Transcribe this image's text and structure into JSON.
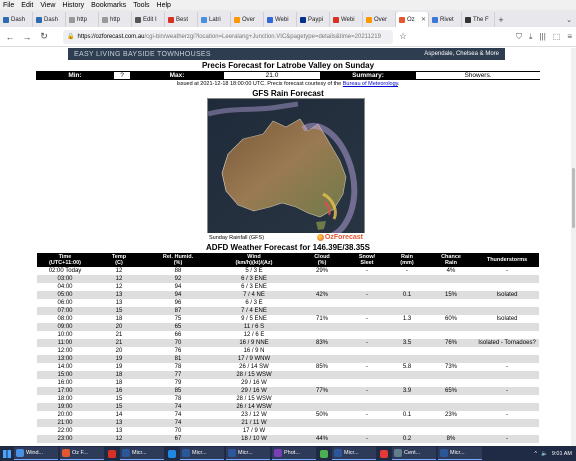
{
  "menubar": [
    "File",
    "Edit",
    "View",
    "History",
    "Bookmarks",
    "Tools",
    "Help"
  ],
  "tabs": [
    {
      "label": "Dash",
      "color": "#2b6cb0"
    },
    {
      "label": "Dash",
      "color": "#2b6cb0"
    },
    {
      "label": "http",
      "color": "#999999"
    },
    {
      "label": "http",
      "color": "#999999"
    },
    {
      "label": "Edit I",
      "color": "#555555"
    },
    {
      "label": "Best",
      "color": "#d93025"
    },
    {
      "label": "Latri",
      "color": "#4a90e2"
    },
    {
      "label": "Over",
      "color": "#ff9800"
    },
    {
      "label": "Webi",
      "color": "#3367d6"
    },
    {
      "label": "Paypi",
      "color": "#003087"
    },
    {
      "label": "Webi",
      "color": "#d93025"
    },
    {
      "label": "Over",
      "color": "#ff9800"
    },
    {
      "label": "Oz",
      "color": "#e4572e",
      "active": true
    },
    {
      "label": "Rivet",
      "color": "#3c78d8"
    },
    {
      "label": "The F",
      "color": "#333333"
    }
  ],
  "url": {
    "host": "https://ozforecast.com.au",
    "path": "/cgi-bin/weatherzgi?location=Leeralang+Junction.VIC&pagetype=details&time=20211219"
  },
  "banner": {
    "left": "EASY LIVING BAYSIDE TOWNHOUSES",
    "right": "Aspendale, Chelsea & More"
  },
  "precis": {
    "title": "Precis Forecast for Latrobe Valley on Sunday",
    "min_label": "Min:",
    "min_value": "?",
    "max_label": "Max:",
    "max_value": "21.0",
    "summary_label": "Summary:",
    "summary_value": "Showers.",
    "issued_text": "Issued at 2021-12-18 18:00:00 UTC. Precis forecast courtesy of the ",
    "issued_link": "Bureau of Meteorology",
    "issued_end": "."
  },
  "gfs": {
    "title": "GFS Rain Forecast",
    "caption": "Sunday Rainfall (GFS)",
    "logo": "OzForecast"
  },
  "adfd": {
    "title": "ADFD Weather Forecast for 146.39E/38.35S",
    "headers": [
      "Time\n(UTC+11:00)",
      "Temp\n(C)",
      "Rel. Humid.\n(%)",
      "Wind\n(km/h)(kt)/(Az)",
      "Cloud\n(%)",
      "Snow/\nSleet",
      "Rain\n(mm)",
      "Chance\nRain",
      "Thunderstorms"
    ],
    "rows": [
      [
        "02:00 Today",
        "12",
        "88",
        "5 / 3 E",
        "29%",
        "-",
        "-",
        "4%",
        "-"
      ],
      [
        "03:00",
        "12",
        "92",
        "6 / 3 ENE",
        "",
        "",
        "",
        "",
        ""
      ],
      [
        "04:00",
        "12",
        "94",
        "6 / 3 ENE",
        "",
        "",
        "",
        "",
        ""
      ],
      [
        "05:00",
        "13",
        "94",
        "7 / 4 NE",
        "42%",
        "-",
        "0.1",
        "15%",
        "Isolated"
      ],
      [
        "06:00",
        "13",
        "96",
        "6 / 3 E",
        "",
        "",
        "",
        "",
        ""
      ],
      [
        "07:00",
        "15",
        "87",
        "7 / 4 ENE",
        "",
        "",
        "",
        "",
        ""
      ],
      [
        "08:00",
        "18",
        "75",
        "9 / 5 ENE",
        "71%",
        "-",
        "1.3",
        "60%",
        "Isolated"
      ],
      [
        "09:00",
        "20",
        "65",
        "11 / 6 S",
        "",
        "",
        "",
        "",
        ""
      ],
      [
        "10:00",
        "21",
        "66",
        "12 / 6 E",
        "",
        "",
        "",
        "",
        ""
      ],
      [
        "11:00",
        "21",
        "70",
        "16 / 9 NNE",
        "83%",
        "-",
        "3.5",
        "76%",
        "Isolated - Tornadoes?"
      ],
      [
        "12:00",
        "20",
        "76",
        "16 / 9 N",
        "",
        "",
        "",
        "",
        ""
      ],
      [
        "13:00",
        "19",
        "81",
        "17 / 9 WNW",
        "",
        "",
        "",
        "",
        ""
      ],
      [
        "14:00",
        "19",
        "78",
        "26 / 14 SW",
        "85%",
        "-",
        "5.8",
        "73%",
        "-"
      ],
      [
        "15:00",
        "18",
        "77",
        "28 / 15 WSW",
        "",
        "",
        "",
        "",
        ""
      ],
      [
        "16:00",
        "18",
        "79",
        "29 / 16 W",
        "",
        "",
        "",
        "",
        ""
      ],
      [
        "17:00",
        "16",
        "85",
        "29 / 16 W",
        "77%",
        "-",
        "3.9",
        "65%",
        "-"
      ],
      [
        "18:00",
        "15",
        "78",
        "28 / 15 WSW",
        "",
        "",
        "",
        "",
        ""
      ],
      [
        "19:00",
        "15",
        "74",
        "26 / 14 WSW",
        "",
        "",
        "",
        "",
        ""
      ],
      [
        "20:00",
        "14",
        "74",
        "23 / 12 W",
        "50%",
        "-",
        "0.1",
        "23%",
        "-"
      ],
      [
        "21:00",
        "13",
        "74",
        "21 / 11 W",
        "",
        "",
        "",
        "",
        ""
      ],
      [
        "22:00",
        "13",
        "70",
        "17 / 9 W",
        "",
        "",
        "",
        "",
        ""
      ],
      [
        "23:00",
        "12",
        "67",
        "18 / 10 W",
        "44%",
        "-",
        "0.2",
        "8%",
        "-"
      ]
    ]
  },
  "taskbar": {
    "items": [
      {
        "label": "Wind...",
        "color": "#4a90e2",
        "wide": true
      },
      {
        "label": "Oz F...",
        "color": "#e4572e",
        "wide": true
      },
      {
        "label": "",
        "color": "#d93025"
      },
      {
        "label": "Micr...",
        "color": "#2b579a",
        "wide": true
      },
      {
        "label": "",
        "color": "#1e88e5"
      },
      {
        "label": "Micr...",
        "color": "#2b579a",
        "wide": true
      },
      {
        "label": "Micr...",
        "color": "#2b579a",
        "wide": true
      },
      {
        "label": "Phot...",
        "color": "#7b3fb5",
        "wide": true
      },
      {
        "label": "",
        "color": "#4caf50"
      },
      {
        "label": "Micr...",
        "color": "#2b579a",
        "wide": true
      },
      {
        "label": "",
        "color": "#e53935"
      },
      {
        "label": "Cent...",
        "color": "#607d8b",
        "wide": true
      },
      {
        "label": "Micr...",
        "color": "#2b579a",
        "wide": true
      }
    ],
    "time": "9:01 AM"
  }
}
